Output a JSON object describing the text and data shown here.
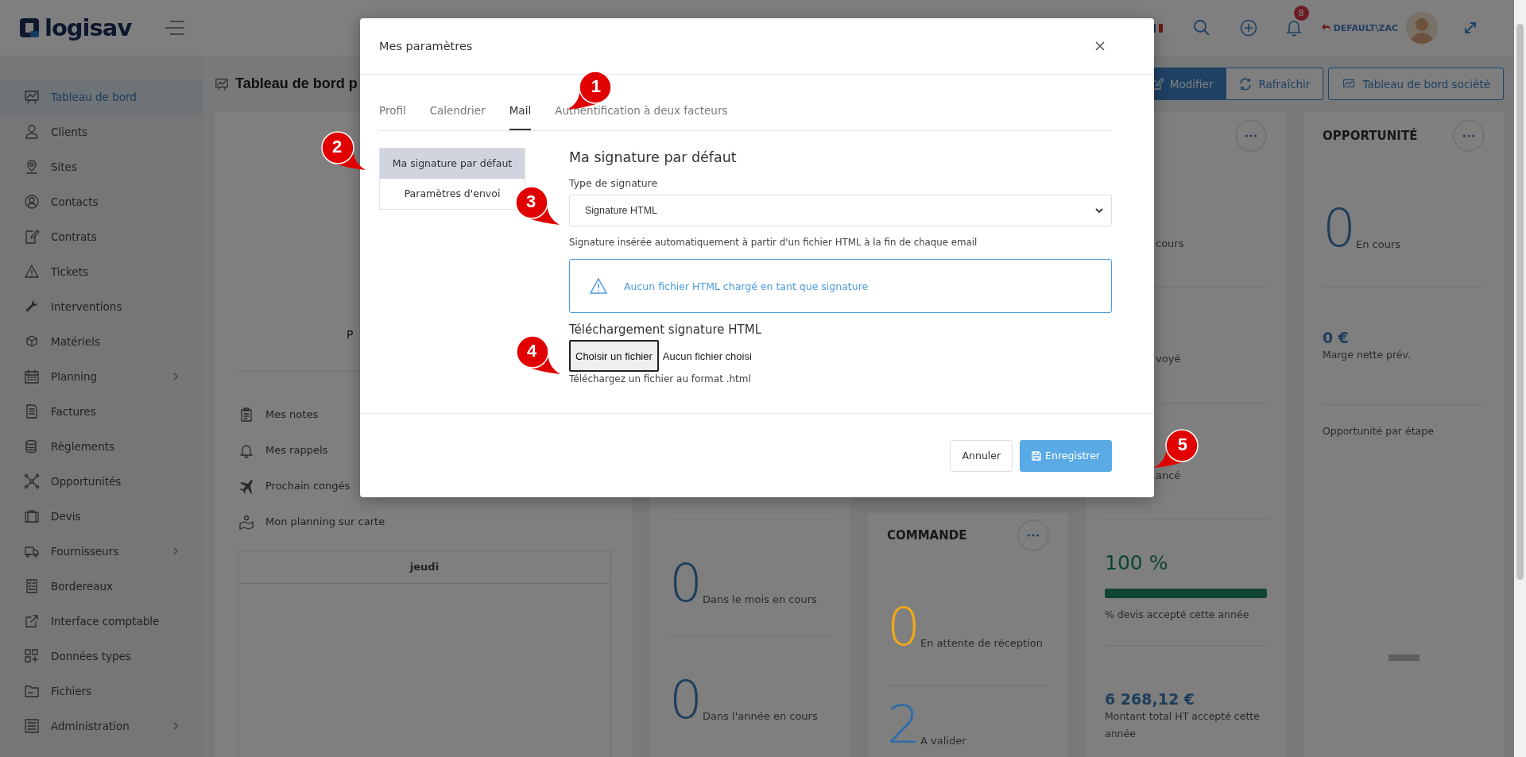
{
  "header": {
    "logo": "logisav",
    "user": "DEFAULT\\ZAC",
    "notification_count": "8"
  },
  "sidebar": {
    "items": [
      {
        "label": "Tableau de bord",
        "selected": true,
        "expandable": false
      },
      {
        "label": "Clients",
        "selected": false,
        "expandable": false
      },
      {
        "label": "Sites",
        "selected": false,
        "expandable": false
      },
      {
        "label": "Contacts",
        "selected": false,
        "expandable": false
      },
      {
        "label": "Contrats",
        "selected": false,
        "expandable": false
      },
      {
        "label": "Tickets",
        "selected": false,
        "expandable": false
      },
      {
        "label": "Interventions",
        "selected": false,
        "expandable": false
      },
      {
        "label": "Matériels",
        "selected": false,
        "expandable": false
      },
      {
        "label": "Planning",
        "selected": false,
        "expandable": true
      },
      {
        "label": "Factures",
        "selected": false,
        "expandable": false
      },
      {
        "label": "Règlements",
        "selected": false,
        "expandable": false
      },
      {
        "label": "Opportunités",
        "selected": false,
        "expandable": false
      },
      {
        "label": "Devis",
        "selected": false,
        "expandable": false
      },
      {
        "label": "Fournisseurs",
        "selected": false,
        "expandable": true
      },
      {
        "label": "Bordereaux",
        "selected": false,
        "expandable": false
      },
      {
        "label": "Interface comptable",
        "selected": false,
        "expandable": false
      },
      {
        "label": "Données types",
        "selected": false,
        "expandable": false
      },
      {
        "label": "Fichiers",
        "selected": false,
        "expandable": false
      },
      {
        "label": "Administration",
        "selected": false,
        "expandable": true
      }
    ]
  },
  "page": {
    "title": "Tableau de bord p",
    "buttons": [
      {
        "label": "Modifier",
        "kind": "primary"
      },
      {
        "label": "Rafraîchir",
        "kind": "outline"
      },
      {
        "label": "Tableau de bord société",
        "kind": "outline"
      }
    ]
  },
  "profile_card": {
    "partial_text": "P",
    "links": [
      "Mes notes",
      "Mes rappels",
      "Prochain congés",
      "Mon planning sur carte"
    ],
    "calendar": {
      "day": "jeudi"
    }
  },
  "stats_card": {
    "items": [
      {
        "value": "0",
        "label": "Dans le mois en cours"
      },
      {
        "value": "0",
        "label": "Dans l'année en cours"
      }
    ]
  },
  "commande_card": {
    "title": "COMMANDE",
    "items": [
      {
        "value": "0",
        "label": "En attente de réception",
        "color": "#f0a818"
      },
      {
        "value": "2",
        "label": "A valider",
        "color": "#2f6ea8"
      }
    ]
  },
  "devis_card": {
    "partial_labels": [
      "cours",
      "voyé",
      "ancé"
    ],
    "percent": "100 %",
    "level": 1,
    "percent_label": "% devis accepté cette année",
    "amount": "6 268,12 €",
    "amount_label": "Montant total HT accepté cette année"
  },
  "opportunite_card": {
    "title": "OPPORTUNITÉ",
    "count": "0",
    "count_label": "En cours",
    "amount": "0 €",
    "amount_label": "Marge nette prév.",
    "chart_title": "Opportunité par étape"
  },
  "modal": {
    "title": "Mes paramètres",
    "tabs": [
      {
        "label": "Profil",
        "selected": false
      },
      {
        "label": "Calendrier",
        "selected": false
      },
      {
        "label": "Mail",
        "selected": true
      },
      {
        "label": "Authentification à deux facteurs",
        "selected": false
      }
    ],
    "nav": [
      {
        "label": "Ma signature par défaut",
        "selected": true
      },
      {
        "label": "Paramètres d'envoi",
        "selected": false
      }
    ],
    "heading": "Ma signature par défaut",
    "type_label": "Type de signature",
    "type_value": "Signature HTML",
    "help": "Signature insérée automatiquement à partir d'un fichier HTML à la fin de chaque email",
    "alert": "Aucun fichier HTML chargé en tant que signature",
    "upload_heading": "Téléchargement signature HTML",
    "file_button": "Choisir un fichier",
    "file_status": "Aucun fichier choisi",
    "file_hint": "Téléchargez un fichier au format .html",
    "buttons": [
      {
        "label": "Annuler",
        "kind": "secondary"
      },
      {
        "label": "Enregistrer",
        "kind": "primary"
      }
    ]
  },
  "annotations": [
    {
      "number": "1"
    },
    {
      "number": "2"
    },
    {
      "number": "3"
    },
    {
      "number": "4"
    },
    {
      "number": "5"
    }
  ]
}
